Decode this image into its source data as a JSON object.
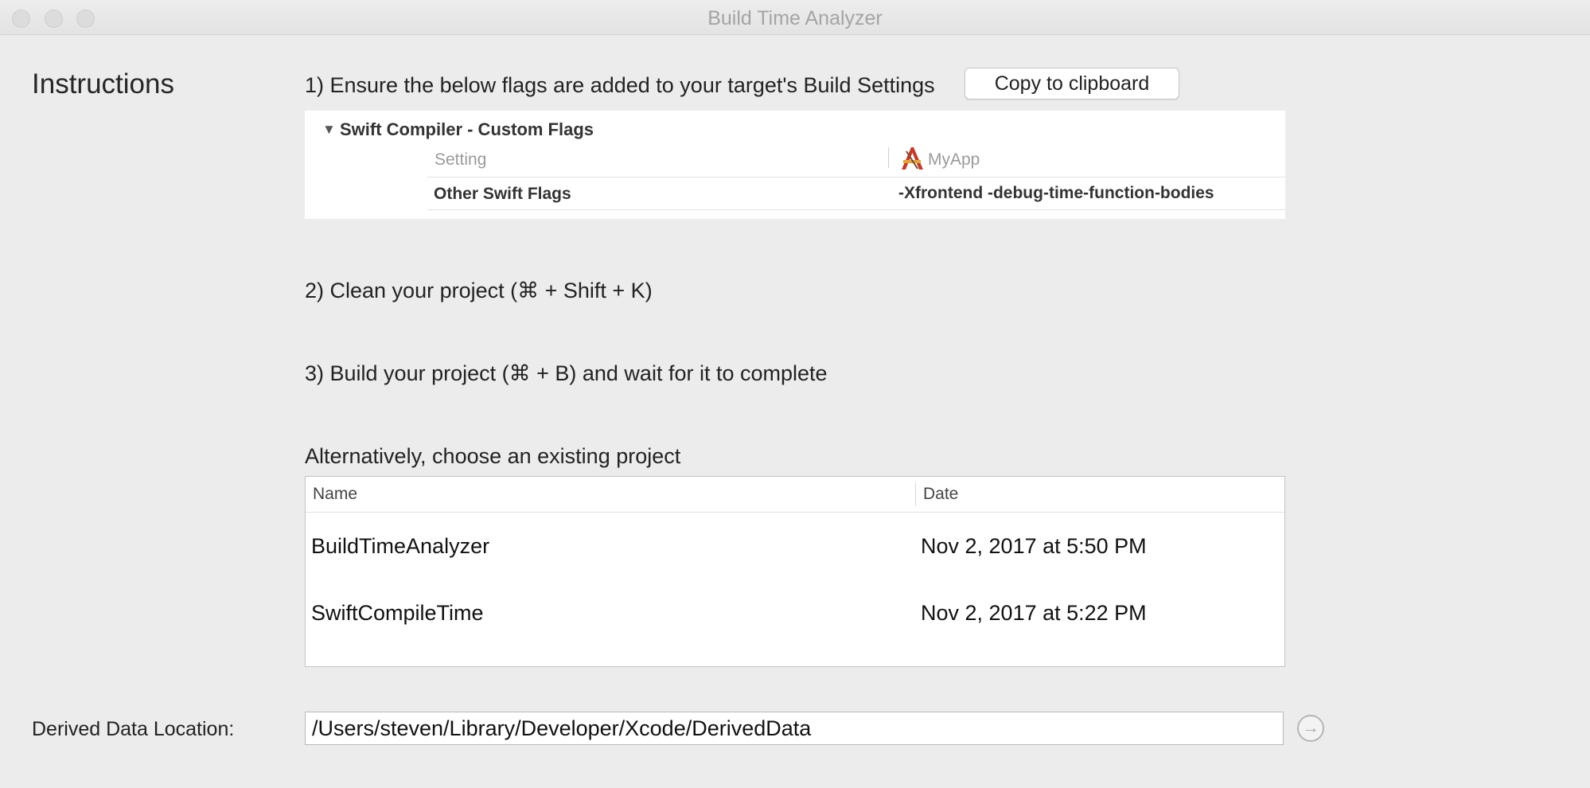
{
  "window": {
    "title": "Build Time Analyzer"
  },
  "instructions": {
    "heading": "Instructions",
    "step1": "1) Ensure the below flags are added to your target's Build Settings",
    "copy_button": "Copy to clipboard",
    "build_settings": {
      "group_title": "Swift Compiler - Custom Flags",
      "col_setting": "Setting",
      "col_target": "MyApp",
      "row_name": "Other Swift Flags",
      "row_value": "-Xfrontend -debug-time-function-bodies"
    },
    "step2": "2) Clean your project (⌘ + Shift + K)",
    "step3": "3) Build your project (⌘ + B) and wait for it to complete",
    "alternative": "Alternatively, choose an existing project"
  },
  "projects": {
    "columns": [
      "Name",
      "Date"
    ],
    "rows": [
      {
        "name": "BuildTimeAnalyzer",
        "date": "Nov 2, 2017 at 5:50 PM"
      },
      {
        "name": "SwiftCompileTime",
        "date": "Nov 2, 2017 at 5:22 PM"
      }
    ]
  },
  "derived_data": {
    "label": "Derived Data Location:",
    "path": "/Users/steven/Library/Developer/Xcode/DerivedData"
  },
  "icons": {
    "disclosure": "disclosure-triangle-icon",
    "app": "xcode-app-icon",
    "go": "arrow-circle-icon"
  }
}
